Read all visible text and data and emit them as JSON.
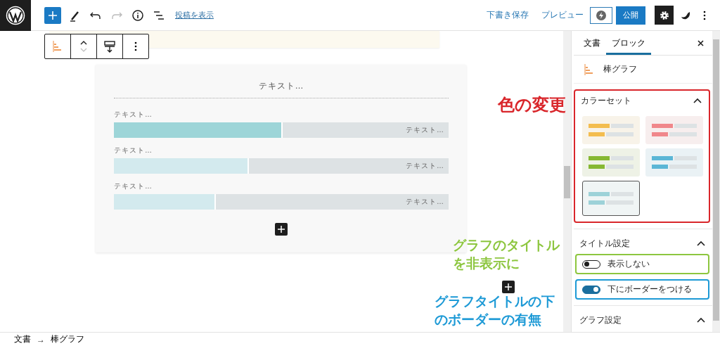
{
  "topbar": {
    "view_post_link": "投稿を表示",
    "save_draft": "下書き保存",
    "preview": "プレビュー",
    "publish": "公開"
  },
  "editor": {
    "chart": {
      "title": "テキスト…",
      "bars": [
        {
          "label": "テキスト…",
          "value_text": "テキスト…",
          "level": 0.5,
          "color": "#9dd5d8"
        },
        {
          "label": "テキスト…",
          "value_text": "テキスト…",
          "level": 0.4,
          "color": "#d3eaee"
        },
        {
          "label": "テキスト…",
          "value_text": "テキスト…",
          "level": 0.3,
          "color": "#d3eaee"
        }
      ]
    }
  },
  "sidebar": {
    "tabs": [
      {
        "label": "文書",
        "selected": false
      },
      {
        "label": "ブロック",
        "selected": true
      }
    ],
    "block_name": "棒グラフ",
    "color_panel": {
      "title": "カラーセット",
      "expanded": true,
      "color_sets": [
        {
          "color": "#f3bd4f",
          "selected": false
        },
        {
          "color": "#f0878b",
          "selected": false
        },
        {
          "color": "#86b832",
          "selected": false
        },
        {
          "color": "#5bb6d6",
          "selected": false
        },
        {
          "color": "#9dd2d8",
          "selected": true
        }
      ]
    },
    "title_panel": {
      "title": "タイトル設定",
      "expanded": true,
      "toggles": [
        {
          "label": "表示しない",
          "on": false
        },
        {
          "label": "下にボーダーをつける",
          "on": true
        }
      ]
    },
    "graph_panel": {
      "title": "グラフ設定",
      "expanded": true
    }
  },
  "breadcrumb": {
    "items": [
      "文書",
      "棒グラフ"
    ],
    "separator": "→"
  },
  "annotations": [
    {
      "lines": [
        "色の変更"
      ],
      "color": "#d9262b"
    },
    {
      "lines": [
        "グラフのタイトル",
        "を非表示に"
      ],
      "color": "#8dc63f"
    },
    {
      "lines": [
        "グラフタイトルの下",
        "のボーダーの有無"
      ],
      "color": "#1e9ad6"
    }
  ]
}
